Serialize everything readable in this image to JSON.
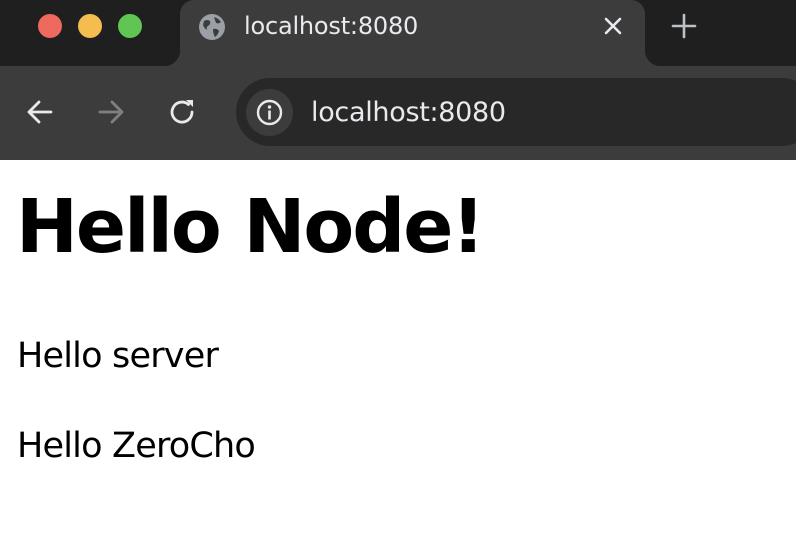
{
  "window": {
    "traffic_lights": {
      "close": "#ee6a5f",
      "minimize": "#f5bd4f",
      "maximize": "#61c554"
    }
  },
  "tab": {
    "title": "localhost:8080",
    "favicon": "globe-icon",
    "close_icon": "close-icon"
  },
  "new_tab_icon": "plus-icon",
  "toolbar": {
    "back_icon": "arrow-left-icon",
    "forward_icon": "arrow-right-icon",
    "reload_icon": "reload-icon",
    "site_info_icon": "info-icon",
    "url": "localhost:8080"
  },
  "page": {
    "heading": "Hello Node!",
    "paragraphs": [
      "Hello server",
      "Hello ZeroCho"
    ]
  }
}
